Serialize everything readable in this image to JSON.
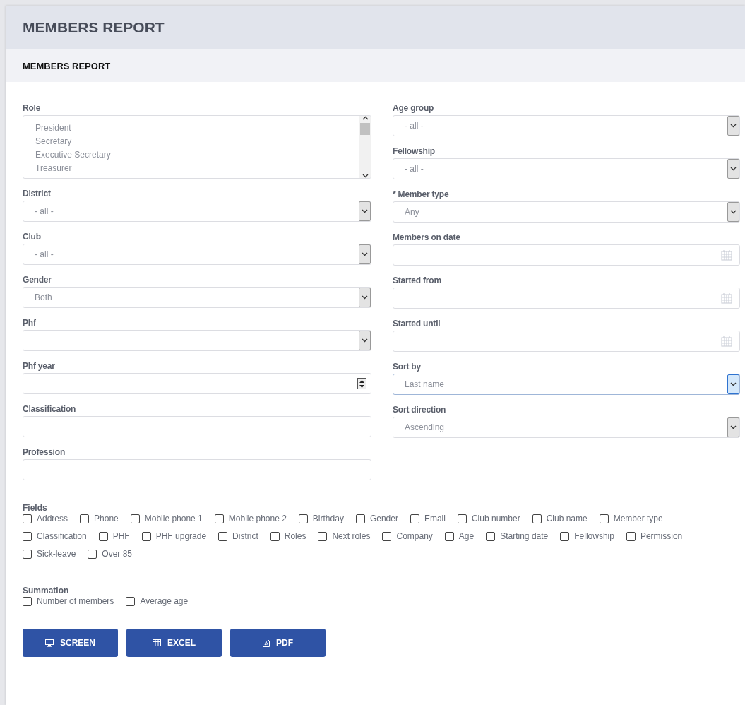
{
  "page_title": "MEMBERS REPORT",
  "section_title": "MEMBERS REPORT",
  "left_fields": [
    {
      "label": "Role",
      "kind": "listbox",
      "options": [
        "President",
        "Secretary",
        "Executive Secretary",
        "Treasurer"
      ]
    },
    {
      "label": "District",
      "kind": "select",
      "focused": false,
      "value": "- all -"
    },
    {
      "label": "Club",
      "kind": "select",
      "focused": false,
      "value": "- all -"
    },
    {
      "label": "Gender",
      "kind": "select",
      "focused": false,
      "value": "Both"
    },
    {
      "label": "Phf",
      "kind": "select",
      "focused": false
    },
    {
      "label": "Phf year",
      "kind": "number"
    },
    {
      "label": "Classification",
      "kind": "text"
    },
    {
      "label": "Profession",
      "kind": "text"
    }
  ],
  "right_fields": [
    {
      "label": "Age group",
      "kind": "select",
      "focused": false,
      "value": "- all -"
    },
    {
      "label": "Fellowship",
      "kind": "select",
      "focused": false,
      "value": "- all -"
    },
    {
      "label": "* Member type",
      "kind": "select",
      "focused": false,
      "value": "Any"
    },
    {
      "label": "Members on date",
      "kind": "date"
    },
    {
      "label": "Started from",
      "kind": "date"
    },
    {
      "label": "Started until",
      "kind": "date"
    },
    {
      "label": "Sort by",
      "kind": "select",
      "focused": true,
      "value": "Last name"
    },
    {
      "label": "Sort direction",
      "kind": "select",
      "focused": false,
      "value": "Ascending"
    }
  ],
  "fields_group": {
    "title": "Fields",
    "options": [
      {
        "label": "Address",
        "checked": false
      },
      {
        "label": "Phone",
        "checked": false
      },
      {
        "label": "Mobile phone 1",
        "checked": false
      },
      {
        "label": "Mobile phone 2",
        "checked": false
      },
      {
        "label": "Birthday",
        "checked": false
      },
      {
        "label": "Gender",
        "checked": false
      },
      {
        "label": "Email",
        "checked": false
      },
      {
        "label": "Club number",
        "checked": false
      },
      {
        "label": "Club name",
        "checked": false
      },
      {
        "label": "Member type",
        "checked": false
      },
      {
        "label": "Classification",
        "checked": false
      },
      {
        "label": "PHF",
        "checked": false
      },
      {
        "label": "PHF upgrade",
        "checked": false
      },
      {
        "label": "District",
        "checked": false
      },
      {
        "label": "Roles",
        "checked": false
      },
      {
        "label": "Next roles",
        "checked": false
      },
      {
        "label": "Company",
        "checked": false
      },
      {
        "label": "Age",
        "checked": false
      },
      {
        "label": "Starting date",
        "checked": false
      },
      {
        "label": "Fellowship",
        "checked": false
      },
      {
        "label": "Permission",
        "checked": false
      },
      {
        "label": "Sick-leave",
        "checked": false
      },
      {
        "label": "Over 85",
        "checked": false
      }
    ]
  },
  "summation_group": {
    "title": "Summation",
    "options": [
      {
        "label": "Number of members",
        "checked": false
      },
      {
        "label": "Average age",
        "checked": false
      }
    ]
  },
  "buttons": [
    {
      "label": "SCREEN",
      "kind": "screen"
    },
    {
      "label": "EXCEL",
      "kind": "excel"
    },
    {
      "label": "PDF",
      "kind": "pdf"
    }
  ]
}
